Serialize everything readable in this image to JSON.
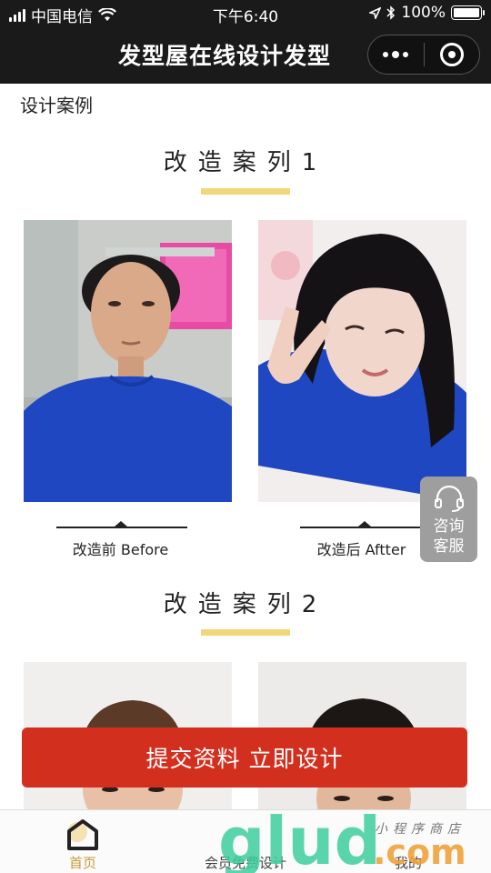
{
  "status_bar": {
    "carrier": "中国电信",
    "time": "下午6:40",
    "battery_percent": "100%",
    "battery_level": 1.0
  },
  "nav": {
    "title": "发型屋在线设计发型"
  },
  "section_label": "设计案例",
  "cases": [
    {
      "title": "改造案列1",
      "before_caption": "改造前 Before",
      "after_caption": "改造后 Aftter"
    },
    {
      "title": "改造案列2"
    }
  ],
  "service_button": {
    "line1": "咨询",
    "line2": "客服"
  },
  "submit_button": "提交资料 立即设计",
  "tabs": [
    {
      "label": "首页",
      "active": true
    },
    {
      "label": "会员免费设计",
      "active": false
    },
    {
      "label": "我的",
      "active": false
    }
  ],
  "watermark": {
    "brand": "glud",
    "suffix": ".com",
    "tagline": "小程序商店"
  },
  "colors": {
    "accent_red": "#d32f1f",
    "underline_yellow": "#f1d77a",
    "tab_active": "#c79a3a",
    "bar_dark": "#1a1a1a"
  }
}
